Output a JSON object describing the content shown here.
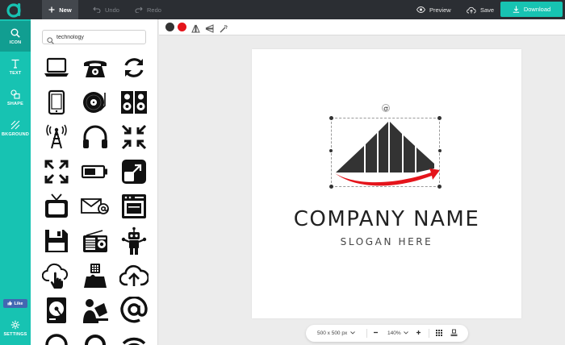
{
  "topbar": {
    "new_label": "New",
    "undo_label": "Undo",
    "redo_label": "Redo",
    "preview_label": "Preview",
    "save_label": "Save",
    "download_label": "Download"
  },
  "sidebar": {
    "items": [
      {
        "label": "ICON",
        "icon": "search-icon",
        "active": true
      },
      {
        "label": "TEXT",
        "icon": "text-icon",
        "active": false
      },
      {
        "label": "SHAPE",
        "icon": "shape-icon",
        "active": false
      },
      {
        "label": "BKGROUND",
        "icon": "background-icon",
        "active": false
      }
    ],
    "like_label": "Like",
    "settings_label": "SETTINGS"
  },
  "icon_panel": {
    "search_value": "technology",
    "icons": [
      "laptop-icon",
      "telephone-icon",
      "refresh-icon",
      "tablet-icon",
      "turntable-icon",
      "speakers-icon",
      "signal-tower-icon",
      "headphones-icon",
      "collapse-arrows-icon",
      "expand-arrows-icon",
      "battery-icon",
      "resize-icon",
      "retro-tv-icon",
      "email-icon",
      "oven-icon",
      "floppy-disk-icon",
      "radio-icon",
      "robot-icon",
      "cloud-touch-icon",
      "keyboard-hand-icon",
      "cloud-upload-icon",
      "hard-drive-icon",
      "person-computer-icon",
      "at-sign-icon"
    ]
  },
  "canvas_toolbar": {
    "colors": [
      "#333333",
      "#e4141b"
    ]
  },
  "artboard": {
    "company_name": "COMPANY NAME",
    "slogan": "SLOGAN HERE"
  },
  "bottom_bar": {
    "canvas_size": "500 x 500 px",
    "zoom": "140%"
  }
}
